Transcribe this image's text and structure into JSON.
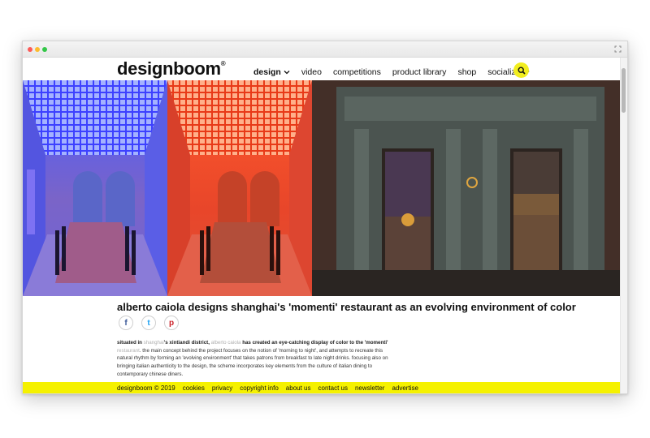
{
  "header": {
    "logo": "designboom",
    "logo_mark": "®",
    "nav": [
      {
        "label": "design",
        "dropdown": true
      },
      {
        "label": "video",
        "dropdown": false
      },
      {
        "label": "competitions",
        "dropdown": false
      },
      {
        "label": "product library",
        "dropdown": false
      },
      {
        "label": "shop",
        "dropdown": false
      },
      {
        "label": "socialize",
        "dropdown": true
      }
    ]
  },
  "article": {
    "title": "alberto caiola designs shanghai's 'momenti' restaurant as an evolving environment of color",
    "body": {
      "p1_a": "situated in ",
      "p1_link1": "shanghai",
      "p1_b": "'s xintiandi district, ",
      "p1_link2": "alberto caiola",
      "p1_c": " has created an eye-catching display of color to the 'momenti' ",
      "p1_link3": "restaurant",
      "p1_d": ". the main concept behind the project focuses on the notion of 'morning to night', and attempts to recreate this natural rhythm by forming an 'evolving environment' that takes patrons from breakfast to late night drinks. focusing also on bringing italian authenticity to the design, the scheme incorporates key elements from the culture of italian dining to contemporary chinese diners."
    }
  },
  "share": {
    "facebook": "f",
    "twitter": "t",
    "pinterest": "p"
  },
  "footer": {
    "items": [
      "designboom © 2019",
      "cookies",
      "privacy",
      "copyright info",
      "about us",
      "contact us",
      "newsletter",
      "advertise"
    ]
  },
  "colors": {
    "accent": "#f5f100",
    "search": "#f2ee1f",
    "link": "#b0b0b0"
  }
}
